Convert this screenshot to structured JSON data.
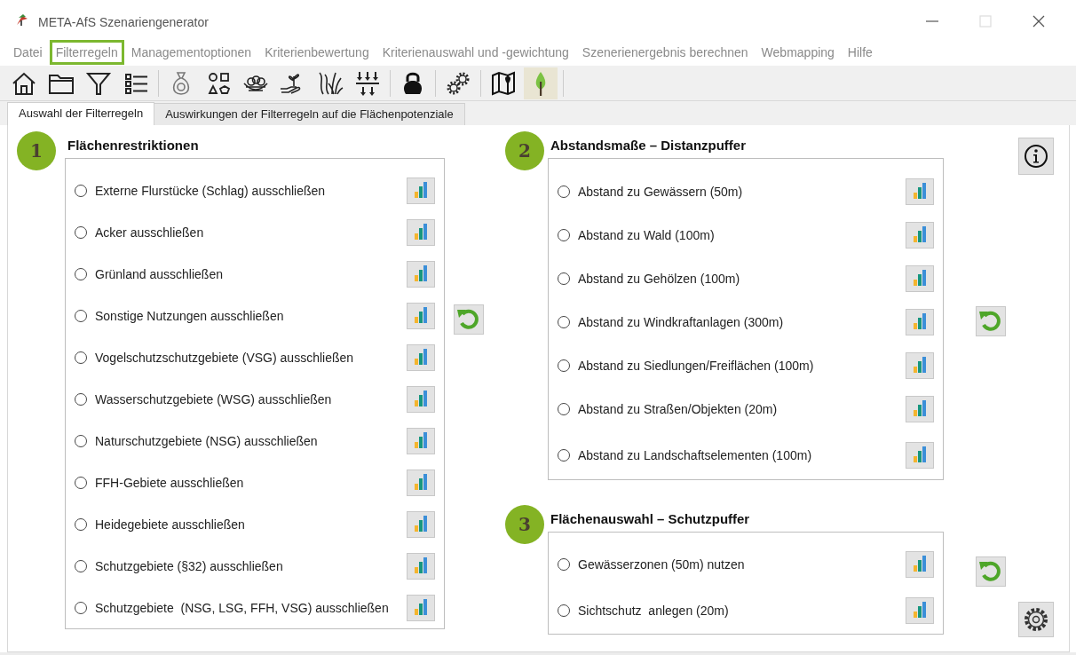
{
  "window": {
    "title": "META-AfS Szenariengenerator"
  },
  "menu": [
    {
      "label": "Datei",
      "selected": false
    },
    {
      "label": "Filterregeln",
      "selected": true
    },
    {
      "label": "Managementoptionen",
      "selected": false
    },
    {
      "label": "Kriterienbewertung",
      "selected": false
    },
    {
      "label": "Kriterienauswahl und -gewichtung",
      "selected": false
    },
    {
      "label": "Szenerienergebnis berechnen",
      "selected": false
    },
    {
      "label": "Webmapping",
      "selected": false
    },
    {
      "label": "Hilfe",
      "selected": false
    }
  ],
  "toolbar": [
    {
      "selected": false
    },
    {
      "selected": false
    },
    {
      "selected": false
    },
    {
      "selected": false
    },
    {
      "selected": false
    },
    {
      "selected": false
    },
    {
      "selected": false
    },
    {
      "selected": false
    },
    {
      "selected": false
    },
    {
      "selected": false
    },
    {
      "selected": false
    },
    {
      "selected": false
    },
    {
      "selected": false
    },
    {
      "selected": true
    }
  ],
  "tabs": [
    {
      "label": "Auswahl der Filterregeln",
      "selected": true
    },
    {
      "label": "Auswirkungen der Filterregeln auf die Flächenpotenziale",
      "selected": false
    }
  ],
  "sections": [
    {
      "number": "1",
      "title": "Flächenrestriktionen",
      "options": [
        {
          "label": "Externe Flurstücke (Schlag) ausschließen",
          "selected": false
        },
        {
          "label": "Acker ausschließen",
          "selected": false
        },
        {
          "label": "Grünland ausschließen",
          "selected": false
        },
        {
          "label": "Sonstige Nutzungen ausschließen",
          "selected": false
        },
        {
          "label": "Vogelschutzschutzgebiete (VSG) ausschließen",
          "selected": false
        },
        {
          "label": "Wasserschutzgebiete (WSG) ausschließen",
          "selected": false
        },
        {
          "label": "Naturschutzgebiete (NSG) ausschließen",
          "selected": false
        },
        {
          "label": "FFH-Gebiete ausschließen",
          "selected": false
        },
        {
          "label": "Heidegebiete ausschließen",
          "selected": false
        },
        {
          "label": "Schutzgebiete (§32) ausschließen",
          "selected": false
        },
        {
          "label": "Schutzgebiete  (NSG, LSG, FFH, VSG) ausschließen",
          "selected": false
        }
      ]
    },
    {
      "number": "2",
      "title": "Abstandsmaße – Distanzpuffer",
      "options": [
        {
          "label": "Abstand zu Gewässern (50m)",
          "selected": false
        },
        {
          "label": "Abstand zu Wald (100m)",
          "selected": false
        },
        {
          "label": "Abstand zu Gehölzen (100m)",
          "selected": false
        },
        {
          "label": "Abstand zu Windkraftanlagen (300m)",
          "selected": false
        },
        {
          "label": "Abstand zu Siedlungen/Freiflächen (100m)",
          "selected": false
        },
        {
          "label": "Abstand zu Straßen/Objekten (20m)",
          "selected": false
        },
        {
          "label": "Abstand zu Landschaftselementen (100m)",
          "selected": false
        }
      ]
    },
    {
      "number": "3",
      "title": "Flächenauswahl – Schutzpuffer",
      "options": [
        {
          "label": "Gewässerzonen (50m) nutzen",
          "selected": false
        },
        {
          "label": "Sichtschutz  anlegen (20m)",
          "selected": false
        }
      ]
    }
  ]
}
